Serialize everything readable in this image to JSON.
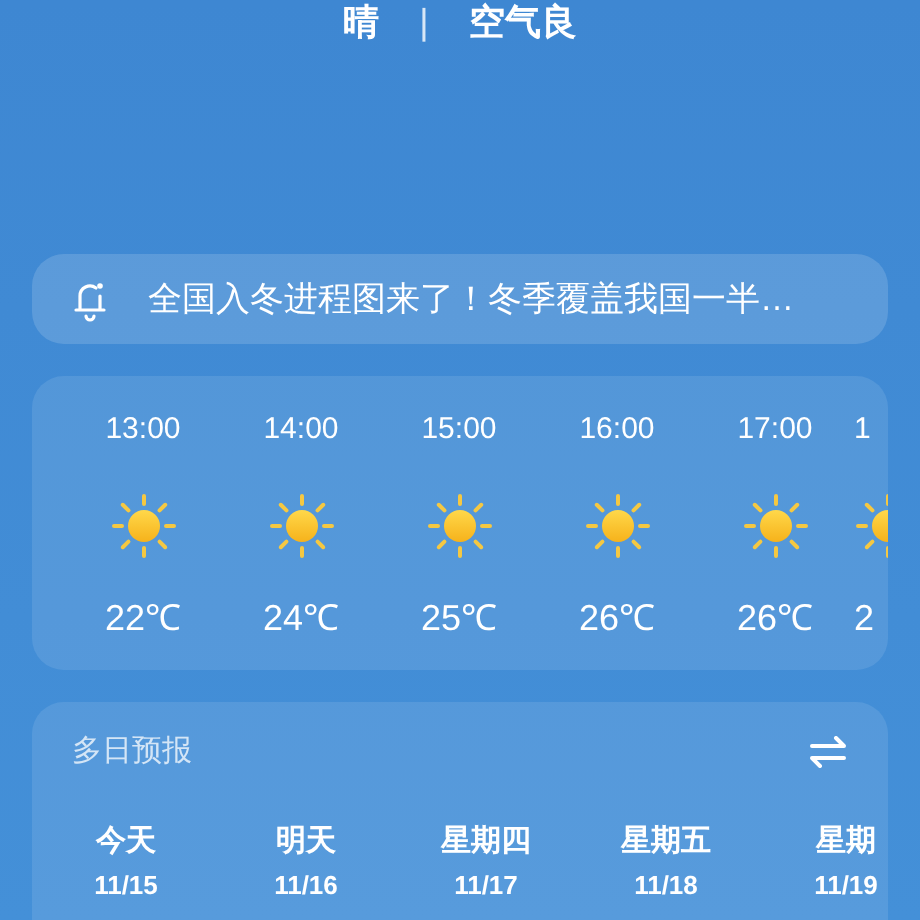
{
  "header": {
    "weather": "晴",
    "separator": "|",
    "air_quality": "空气良"
  },
  "notice": {
    "text": "全国入冬进程图来了！冬季覆盖我国一半…"
  },
  "hourly": [
    {
      "time": "13:00",
      "temp": "22℃",
      "kind": "full"
    },
    {
      "time": "14:00",
      "temp": "24℃",
      "kind": "full"
    },
    {
      "time": "15:00",
      "temp": "25℃",
      "kind": "full"
    },
    {
      "time": "16:00",
      "temp": "26℃",
      "kind": "full"
    },
    {
      "time": "17:00",
      "temp": "26℃",
      "kind": "full"
    },
    {
      "time": "1",
      "temp": "2",
      "kind": "partial"
    }
  ],
  "forecast": {
    "title": "多日预报",
    "days": [
      {
        "day": "今天",
        "date": "11/15"
      },
      {
        "day": "明天",
        "date": "11/16"
      },
      {
        "day": "星期四",
        "date": "11/17"
      },
      {
        "day": "星期五",
        "date": "11/18"
      },
      {
        "day": "星期",
        "date": "11/19"
      }
    ]
  }
}
